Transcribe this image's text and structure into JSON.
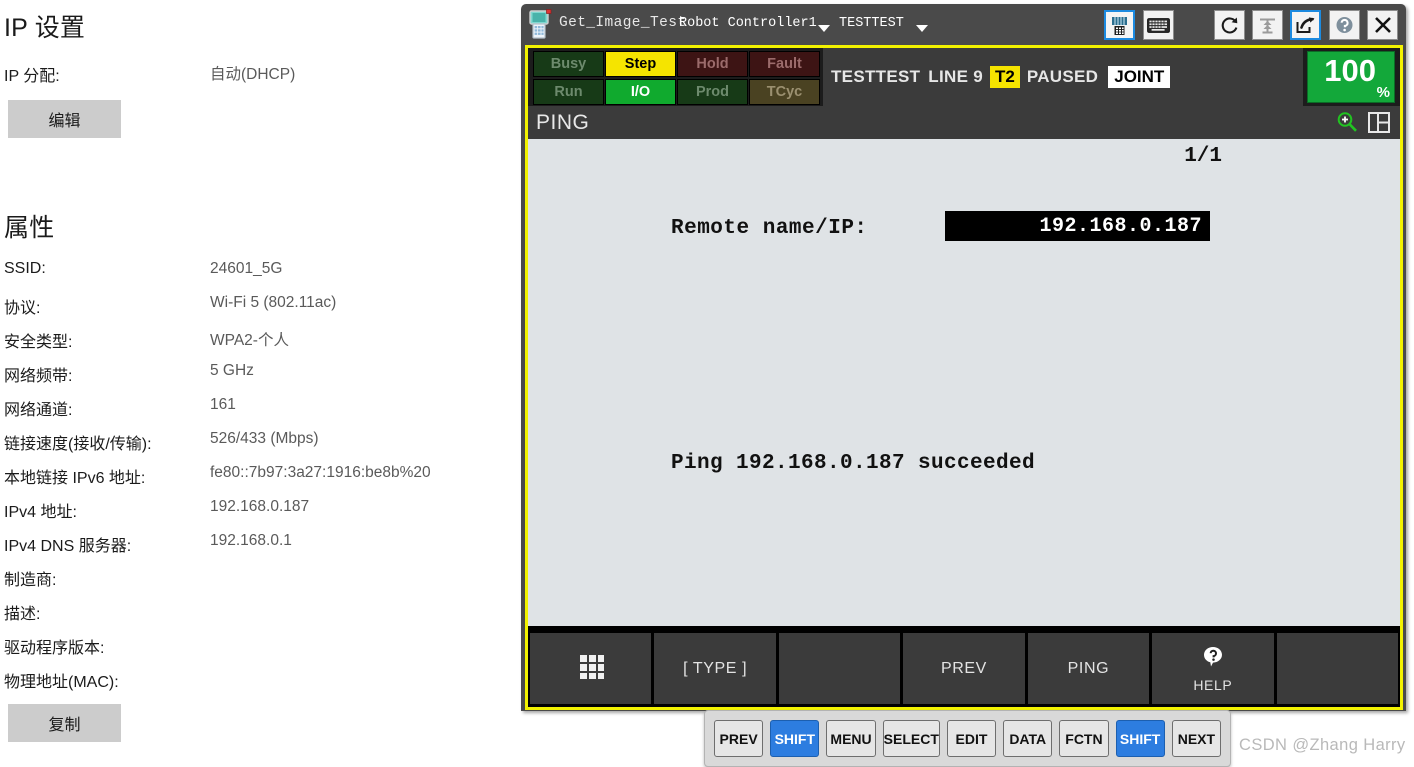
{
  "windows_panel": {
    "ip_settings_title": "IP 设置",
    "ip_assign_label": "IP 分配:",
    "ip_assign_value": "自动(DHCP)",
    "edit_button": "编辑",
    "properties_title": "属性",
    "copy_button": "复制",
    "properties": [
      {
        "label": "SSID:",
        "value": "24601_5G"
      },
      {
        "label": "协议:",
        "value": "Wi-Fi 5 (802.11ac)"
      },
      {
        "label": "安全类型:",
        "value": "WPA2-个人"
      },
      {
        "label": "网络频带:",
        "value": "5 GHz"
      },
      {
        "label": "网络通道:",
        "value": "161"
      },
      {
        "label": "链接速度(接收/传输):",
        "value": "526/433 (Mbps)"
      },
      {
        "label": "本地链接 IPv6 地址:",
        "value": "fe80::7b97:3a27:1916:be8b%20"
      },
      {
        "label": "IPv4 地址:",
        "value": "192.168.0.187"
      },
      {
        "label": "IPv4 DNS 服务器:",
        "value": "192.168.0.1"
      },
      {
        "label": "制造商:",
        "value": ""
      },
      {
        "label": "描述:",
        "value": ""
      },
      {
        "label": "驱动程序版本:",
        "value": ""
      },
      {
        "label": "物理地址(MAC):",
        "value": ""
      }
    ]
  },
  "pendant": {
    "titlebar": {
      "app_name": "Get_Image_Test",
      "controller_name": "Robot Controller1",
      "program_name": "TESTTEST",
      "icons": {
        "device": "teach-pendant-icon",
        "pendant_view": "pendant-view-icon",
        "keyboard": "keyboard-icon",
        "refresh": "refresh-icon",
        "robot": "robot-icon",
        "launch": "launch-icon",
        "help": "help-icon",
        "close": "close-icon"
      }
    },
    "status_lights": [
      {
        "label": "Busy",
        "state": "off-green"
      },
      {
        "label": "Step",
        "state": "on-yellow"
      },
      {
        "label": "Hold",
        "state": "off-red"
      },
      {
        "label": "Fault",
        "state": "off-red"
      },
      {
        "label": "Run",
        "state": "off-green"
      },
      {
        "label": "I/O",
        "state": "on-green"
      },
      {
        "label": "Prod",
        "state": "off-green"
      },
      {
        "label": "TCyc",
        "state": "off-olive"
      }
    ],
    "status_line": {
      "program": "TESTTEST",
      "line": "LINE 9",
      "mode": "T2",
      "run_state": "PAUSED",
      "coord": "JOINT"
    },
    "speed": {
      "value": "100",
      "unit": "%"
    },
    "page": {
      "title": "PING",
      "page_indicator": "1/1",
      "remote_label": "Remote name/IP:",
      "remote_value": "192.168.0.187",
      "result_text": "Ping 192.168.0.187 succeeded"
    },
    "function_keys": [
      {
        "label": "",
        "icon": "grid-icon"
      },
      {
        "label": "[ TYPE ]",
        "icon": ""
      },
      {
        "label": "",
        "icon": ""
      },
      {
        "label": "PREV",
        "icon": ""
      },
      {
        "label": "PING",
        "icon": ""
      },
      {
        "label": "HELP",
        "icon": "help-bubble-icon"
      },
      {
        "label": "",
        "icon": ""
      }
    ],
    "keypad": [
      {
        "label": "PREV",
        "highlight": false
      },
      {
        "label": "SHIFT",
        "highlight": true
      },
      {
        "label": "MENU",
        "highlight": false
      },
      {
        "label": "SELECT",
        "highlight": false
      },
      {
        "label": "EDIT",
        "highlight": false
      },
      {
        "label": "DATA",
        "highlight": false
      },
      {
        "label": "FCTN",
        "highlight": false
      },
      {
        "label": "SHIFT",
        "highlight": true
      },
      {
        "label": "NEXT",
        "highlight": false
      }
    ]
  },
  "watermark": "CSDN @Zhang Harry",
  "colors": {
    "frame_yellow": "#f2f200",
    "speed_green": "#13a83a",
    "mode_yellow": "#f5e400",
    "shift_blue": "#2d7de0",
    "screen_bg": "#dfe3e6"
  }
}
